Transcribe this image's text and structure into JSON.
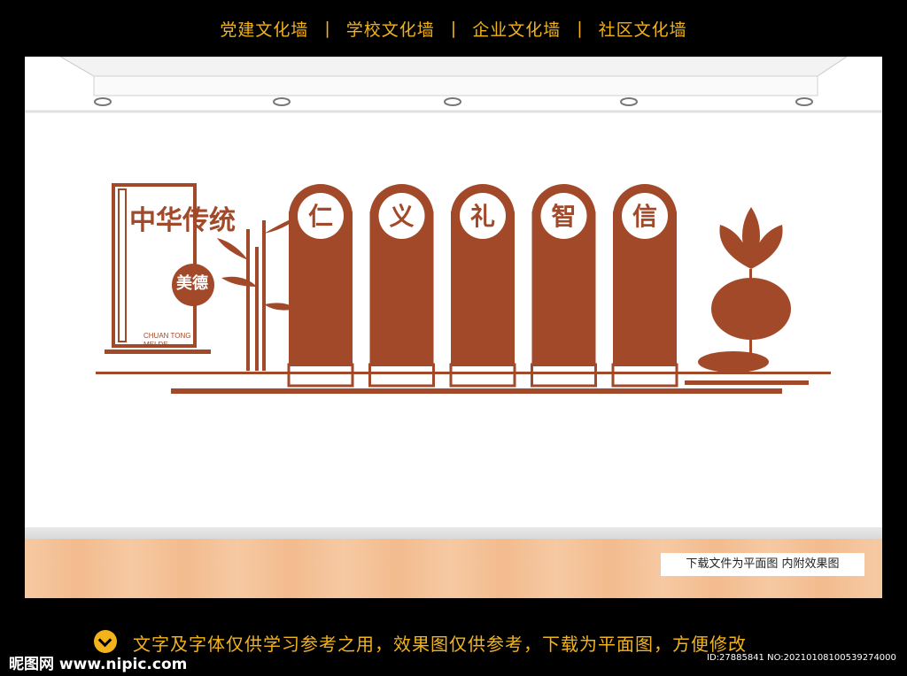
{
  "nav": {
    "items": [
      "党建文化墙",
      "学校文化墙",
      "企业文化墙",
      "社区文化墙"
    ],
    "separator": "|"
  },
  "mural": {
    "title": "中华传统",
    "seal": "美德",
    "pinyin_line1": "CHUAN TONG",
    "pinyin_line2": "MEI DE",
    "panels": [
      "仁",
      "义",
      "礼",
      "智",
      "信"
    ],
    "color": "#a2492a"
  },
  "notice": "下载文件为平面图  内附效果图",
  "footer": {
    "note": "文字及字体仅供学习参考之用，效果图仅供参考，下载为平面图，方便修改",
    "brand": "昵图网 www.nipic.com",
    "code": "ID:27885841 NO:20210108100539274000"
  },
  "colors": {
    "accent": "#f2b31b",
    "mural": "#a2492a"
  }
}
